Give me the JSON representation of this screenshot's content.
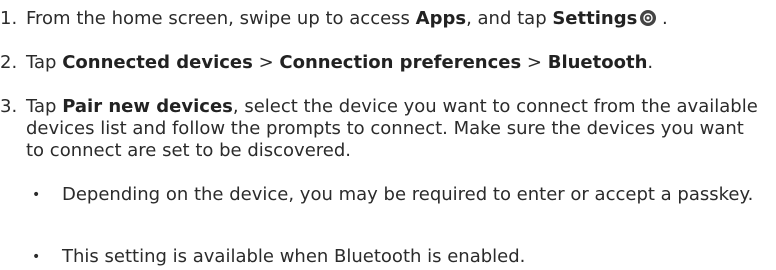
{
  "steps": [
    {
      "number": "1.",
      "parts": {
        "a": "From the home screen, swipe up to access ",
        "b": "Apps",
        "c": ", and tap ",
        "d": "Settings",
        "e": " ."
      },
      "icon": "settings-gear-icon"
    },
    {
      "number": "2.",
      "parts": {
        "a": "Tap ",
        "b": "Connected devices",
        "c": " > ",
        "d": "Connection preferences",
        "e": " > ",
        "f": "Bluetooth",
        "g": "."
      }
    },
    {
      "number": "3.",
      "parts": {
        "a": "Tap ",
        "b": "Pair new devices",
        "c": ", select the device you want to connect from the available devices list and follow the prompts to connect. Make sure the devices you want to connect are set to be discovered."
      }
    }
  ],
  "bullets": [
    {
      "text": "Depending on the device, you may be required to enter or accept a passkey."
    },
    {
      "text": "This setting is available when Bluetooth is enabled."
    }
  ],
  "bullet_char": "•"
}
